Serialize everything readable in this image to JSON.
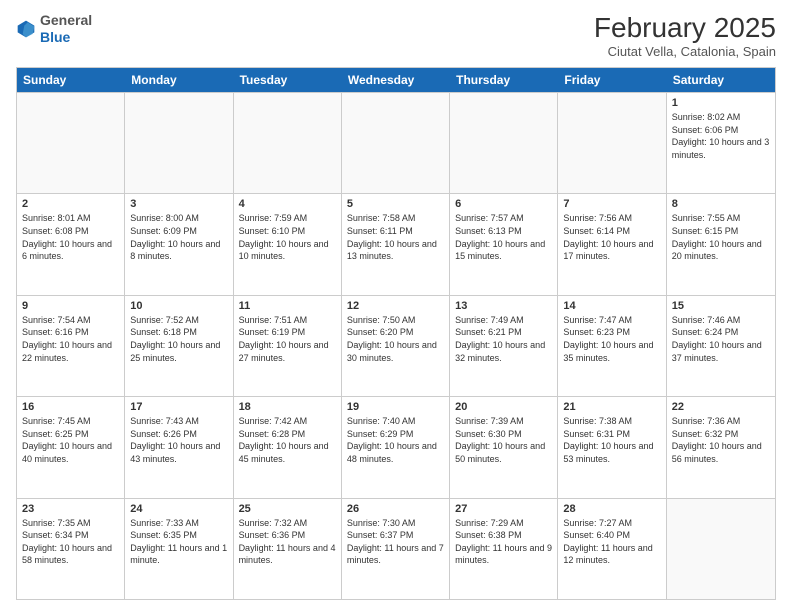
{
  "header": {
    "logo_general": "General",
    "logo_blue": "Blue",
    "month_title": "February 2025",
    "location": "Ciutat Vella, Catalonia, Spain"
  },
  "weekdays": [
    "Sunday",
    "Monday",
    "Tuesday",
    "Wednesday",
    "Thursday",
    "Friday",
    "Saturday"
  ],
  "weeks": [
    [
      {
        "day": "",
        "info": ""
      },
      {
        "day": "",
        "info": ""
      },
      {
        "day": "",
        "info": ""
      },
      {
        "day": "",
        "info": ""
      },
      {
        "day": "",
        "info": ""
      },
      {
        "day": "",
        "info": ""
      },
      {
        "day": "1",
        "info": "Sunrise: 8:02 AM\nSunset: 6:06 PM\nDaylight: 10 hours and 3 minutes."
      }
    ],
    [
      {
        "day": "2",
        "info": "Sunrise: 8:01 AM\nSunset: 6:08 PM\nDaylight: 10 hours and 6 minutes."
      },
      {
        "day": "3",
        "info": "Sunrise: 8:00 AM\nSunset: 6:09 PM\nDaylight: 10 hours and 8 minutes."
      },
      {
        "day": "4",
        "info": "Sunrise: 7:59 AM\nSunset: 6:10 PM\nDaylight: 10 hours and 10 minutes."
      },
      {
        "day": "5",
        "info": "Sunrise: 7:58 AM\nSunset: 6:11 PM\nDaylight: 10 hours and 13 minutes."
      },
      {
        "day": "6",
        "info": "Sunrise: 7:57 AM\nSunset: 6:13 PM\nDaylight: 10 hours and 15 minutes."
      },
      {
        "day": "7",
        "info": "Sunrise: 7:56 AM\nSunset: 6:14 PM\nDaylight: 10 hours and 17 minutes."
      },
      {
        "day": "8",
        "info": "Sunrise: 7:55 AM\nSunset: 6:15 PM\nDaylight: 10 hours and 20 minutes."
      }
    ],
    [
      {
        "day": "9",
        "info": "Sunrise: 7:54 AM\nSunset: 6:16 PM\nDaylight: 10 hours and 22 minutes."
      },
      {
        "day": "10",
        "info": "Sunrise: 7:52 AM\nSunset: 6:18 PM\nDaylight: 10 hours and 25 minutes."
      },
      {
        "day": "11",
        "info": "Sunrise: 7:51 AM\nSunset: 6:19 PM\nDaylight: 10 hours and 27 minutes."
      },
      {
        "day": "12",
        "info": "Sunrise: 7:50 AM\nSunset: 6:20 PM\nDaylight: 10 hours and 30 minutes."
      },
      {
        "day": "13",
        "info": "Sunrise: 7:49 AM\nSunset: 6:21 PM\nDaylight: 10 hours and 32 minutes."
      },
      {
        "day": "14",
        "info": "Sunrise: 7:47 AM\nSunset: 6:23 PM\nDaylight: 10 hours and 35 minutes."
      },
      {
        "day": "15",
        "info": "Sunrise: 7:46 AM\nSunset: 6:24 PM\nDaylight: 10 hours and 37 minutes."
      }
    ],
    [
      {
        "day": "16",
        "info": "Sunrise: 7:45 AM\nSunset: 6:25 PM\nDaylight: 10 hours and 40 minutes."
      },
      {
        "day": "17",
        "info": "Sunrise: 7:43 AM\nSunset: 6:26 PM\nDaylight: 10 hours and 43 minutes."
      },
      {
        "day": "18",
        "info": "Sunrise: 7:42 AM\nSunset: 6:28 PM\nDaylight: 10 hours and 45 minutes."
      },
      {
        "day": "19",
        "info": "Sunrise: 7:40 AM\nSunset: 6:29 PM\nDaylight: 10 hours and 48 minutes."
      },
      {
        "day": "20",
        "info": "Sunrise: 7:39 AM\nSunset: 6:30 PM\nDaylight: 10 hours and 50 minutes."
      },
      {
        "day": "21",
        "info": "Sunrise: 7:38 AM\nSunset: 6:31 PM\nDaylight: 10 hours and 53 minutes."
      },
      {
        "day": "22",
        "info": "Sunrise: 7:36 AM\nSunset: 6:32 PM\nDaylight: 10 hours and 56 minutes."
      }
    ],
    [
      {
        "day": "23",
        "info": "Sunrise: 7:35 AM\nSunset: 6:34 PM\nDaylight: 10 hours and 58 minutes."
      },
      {
        "day": "24",
        "info": "Sunrise: 7:33 AM\nSunset: 6:35 PM\nDaylight: 11 hours and 1 minute."
      },
      {
        "day": "25",
        "info": "Sunrise: 7:32 AM\nSunset: 6:36 PM\nDaylight: 11 hours and 4 minutes."
      },
      {
        "day": "26",
        "info": "Sunrise: 7:30 AM\nSunset: 6:37 PM\nDaylight: 11 hours and 7 minutes."
      },
      {
        "day": "27",
        "info": "Sunrise: 7:29 AM\nSunset: 6:38 PM\nDaylight: 11 hours and 9 minutes."
      },
      {
        "day": "28",
        "info": "Sunrise: 7:27 AM\nSunset: 6:40 PM\nDaylight: 11 hours and 12 minutes."
      },
      {
        "day": "",
        "info": ""
      }
    ]
  ]
}
